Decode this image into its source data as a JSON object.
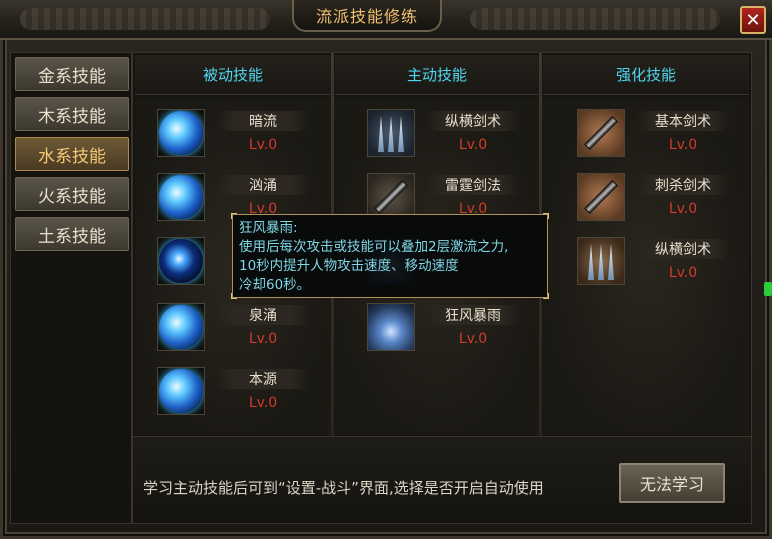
{
  "window": {
    "title": "流派技能修练",
    "close_label": "✕"
  },
  "tabs": [
    {
      "label": "金系技能",
      "active": false
    },
    {
      "label": "木系技能",
      "active": false
    },
    {
      "label": "水系技能",
      "active": true
    },
    {
      "label": "火系技能",
      "active": false
    },
    {
      "label": "土系技能",
      "active": false
    }
  ],
  "columns": {
    "passive": {
      "header": "被动技能",
      "skills": [
        {
          "name": "暗流",
          "level": "Lv.0",
          "icon": "water-orb-icon"
        },
        {
          "name": "汹涌",
          "level": "Lv.0",
          "icon": "water-wave-icon"
        },
        {
          "name": "",
          "level": "",
          "icon": "dark-water-orb-icon"
        },
        {
          "name": "泉涌",
          "level": "Lv.0",
          "icon": "water-drop-icon"
        },
        {
          "name": "本源",
          "level": "Lv.0",
          "icon": "water-swirl-icon"
        }
      ]
    },
    "active": {
      "header": "主动技能",
      "skills": [
        {
          "name": "纵横剑术",
          "level": "Lv.0",
          "icon": "claw-blades-icon"
        },
        {
          "name": "雷霆剑法",
          "level": "Lv.0",
          "icon": "sword-icon"
        },
        {
          "name": "",
          "level": "",
          "icon": "storm-icon"
        },
        {
          "name": "狂风暴雨",
          "level": "Lv.0",
          "icon": "storm-icon"
        }
      ]
    },
    "enhance": {
      "header": "强化技能",
      "skills": [
        {
          "name": "基本剑术",
          "level": "Lv.0",
          "icon": "sword-icon"
        },
        {
          "name": "刺杀剑术",
          "level": "Lv.0",
          "icon": "sword-icon"
        },
        {
          "name": "纵横剑术",
          "level": "Lv.0",
          "icon": "claw-blades-icon"
        }
      ]
    }
  },
  "tooltip": {
    "title": "狂风暴雨:",
    "line1": "使用后每次攻击或技能可以叠加2层激流之力,",
    "line2": "10秒内提升人物攻击速度、移动速度",
    "line3": "冷却60秒。"
  },
  "footer": {
    "hint": "学习主动技能后可到“设置-战斗”界面,选择是否开启自动使用",
    "learn_button": "无法学习"
  },
  "colors": {
    "header_cyan": "#4fd7f0",
    "level_red": "#d33b2b",
    "title_gold": "#f0c070",
    "tooltip_text": "#7fd6e6"
  }
}
